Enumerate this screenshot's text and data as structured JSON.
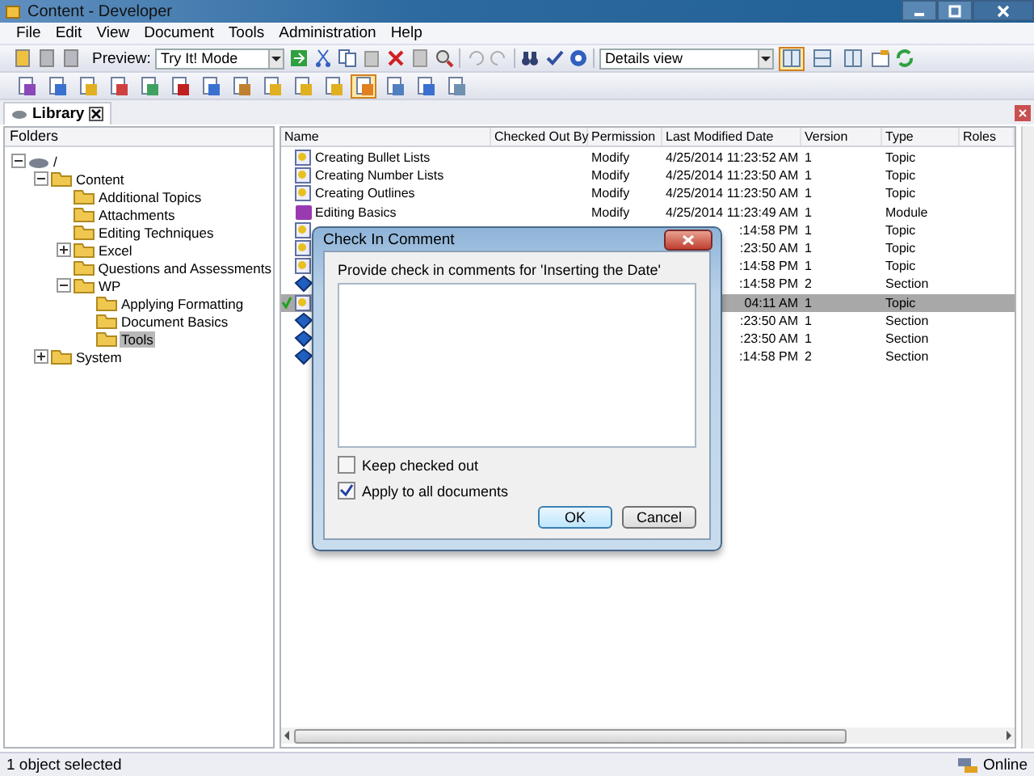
{
  "window": {
    "title": "Content - Developer"
  },
  "menu": [
    "File",
    "Edit",
    "View",
    "Document",
    "Tools",
    "Administration",
    "Help"
  ],
  "toolbar": {
    "preview_label": "Preview:",
    "preview_mode": "Try It! Mode",
    "view_mode": "Details view",
    "view_buttons": [
      {
        "selected": true
      },
      {
        "selected": false
      },
      {
        "selected": false
      }
    ],
    "tool_buttons": [
      {
        "selected": false
      },
      {
        "selected": false
      },
      {
        "selected": false
      },
      {
        "selected": false
      },
      {
        "selected": false
      },
      {
        "selected": false
      },
      {
        "selected": false
      },
      {
        "selected": false
      },
      {
        "selected": false
      },
      {
        "selected": false
      },
      {
        "selected": false
      },
      {
        "selected": true
      },
      {
        "selected": false
      },
      {
        "selected": false
      },
      {
        "selected": false
      }
    ]
  },
  "tabs": [
    {
      "label": "Library",
      "selected": true
    }
  ],
  "folders": {
    "header": "Folders",
    "tree": [
      {
        "label": "/",
        "selected": false,
        "expanded": true,
        "children": [
          {
            "label": "Content",
            "selected": false,
            "expanded": true,
            "children": [
              {
                "label": "Additional Topics",
                "selected": false
              },
              {
                "label": "Attachments",
                "selected": false
              },
              {
                "label": "Editing Techniques",
                "selected": false
              },
              {
                "label": "Excel",
                "selected": false,
                "expanded": false
              },
              {
                "label": "Questions and Assessments",
                "selected": false
              },
              {
                "label": "WP",
                "selected": false,
                "expanded": true,
                "children": [
                  {
                    "label": "Applying Formatting",
                    "selected": false
                  },
                  {
                    "label": "Document Basics",
                    "selected": false
                  },
                  {
                    "label": "Tools",
                    "selected": true
                  }
                ]
              }
            ]
          },
          {
            "label": "System",
            "selected": false,
            "expanded": false
          }
        ]
      }
    ]
  },
  "table": {
    "columns": [
      "Name",
      "Checked Out By",
      "Permission",
      "Last Modified Date",
      "Version",
      "Type",
      "Roles"
    ],
    "rows": [
      {
        "name": "Creating Bullet Lists",
        "permission": "Modify",
        "date": "4/25/2014 11:23:52 AM",
        "version": "1",
        "type": "Topic",
        "kind": "topic",
        "checked_out": false,
        "selected": false
      },
      {
        "name": "Creating Number Lists",
        "permission": "Modify",
        "date": "4/25/2014 11:23:50 AM",
        "version": "1",
        "type": "Topic",
        "kind": "topic",
        "checked_out": false,
        "selected": false
      },
      {
        "name": "Creating Outlines",
        "permission": "Modify",
        "date": "4/25/2014 11:23:50 AM",
        "version": "1",
        "type": "Topic",
        "kind": "topic",
        "checked_out": false,
        "selected": false
      },
      {
        "name": "Editing Basics",
        "permission": "Modify",
        "date": "4/25/2014 11:23:49 AM",
        "version": "1",
        "type": "Module",
        "kind": "module",
        "checked_out": false,
        "selected": false
      },
      {
        "date": ":14:58 PM",
        "version": "1",
        "type": "Topic",
        "kind": "topic",
        "checked_out": false,
        "selected": false
      },
      {
        "date": ":23:50 AM",
        "version": "1",
        "type": "Topic",
        "kind": "topic",
        "checked_out": false,
        "selected": false
      },
      {
        "date": ":14:58 PM",
        "version": "1",
        "type": "Topic",
        "kind": "topic",
        "checked_out": false,
        "selected": false
      },
      {
        "date": ":14:58 PM",
        "version": "2",
        "type": "Section",
        "kind": "section",
        "checked_out": false,
        "selected": false
      },
      {
        "date": "04:11 AM",
        "version": "1",
        "type": "Topic",
        "kind": "topic",
        "checked_out": true,
        "selected": true
      },
      {
        "date": ":23:50 AM",
        "version": "1",
        "type": "Section",
        "kind": "section",
        "checked_out": false,
        "selected": false
      },
      {
        "date": ":23:50 AM",
        "version": "1",
        "type": "Section",
        "kind": "section",
        "checked_out": false,
        "selected": false
      },
      {
        "date": ":14:58 PM",
        "version": "2",
        "type": "Section",
        "kind": "section",
        "checked_out": false,
        "selected": false
      }
    ]
  },
  "dialog": {
    "title": "Check In Comment",
    "prompt": "Provide check in comments for 'Inserting the Date'",
    "options": [
      {
        "label": "Keep checked out",
        "checked": false
      },
      {
        "label": "Apply to all documents",
        "checked": true
      }
    ],
    "buttons": [
      "OK",
      "Cancel"
    ]
  },
  "status_bar": {
    "message": "1 object selected",
    "connection": "Online"
  }
}
